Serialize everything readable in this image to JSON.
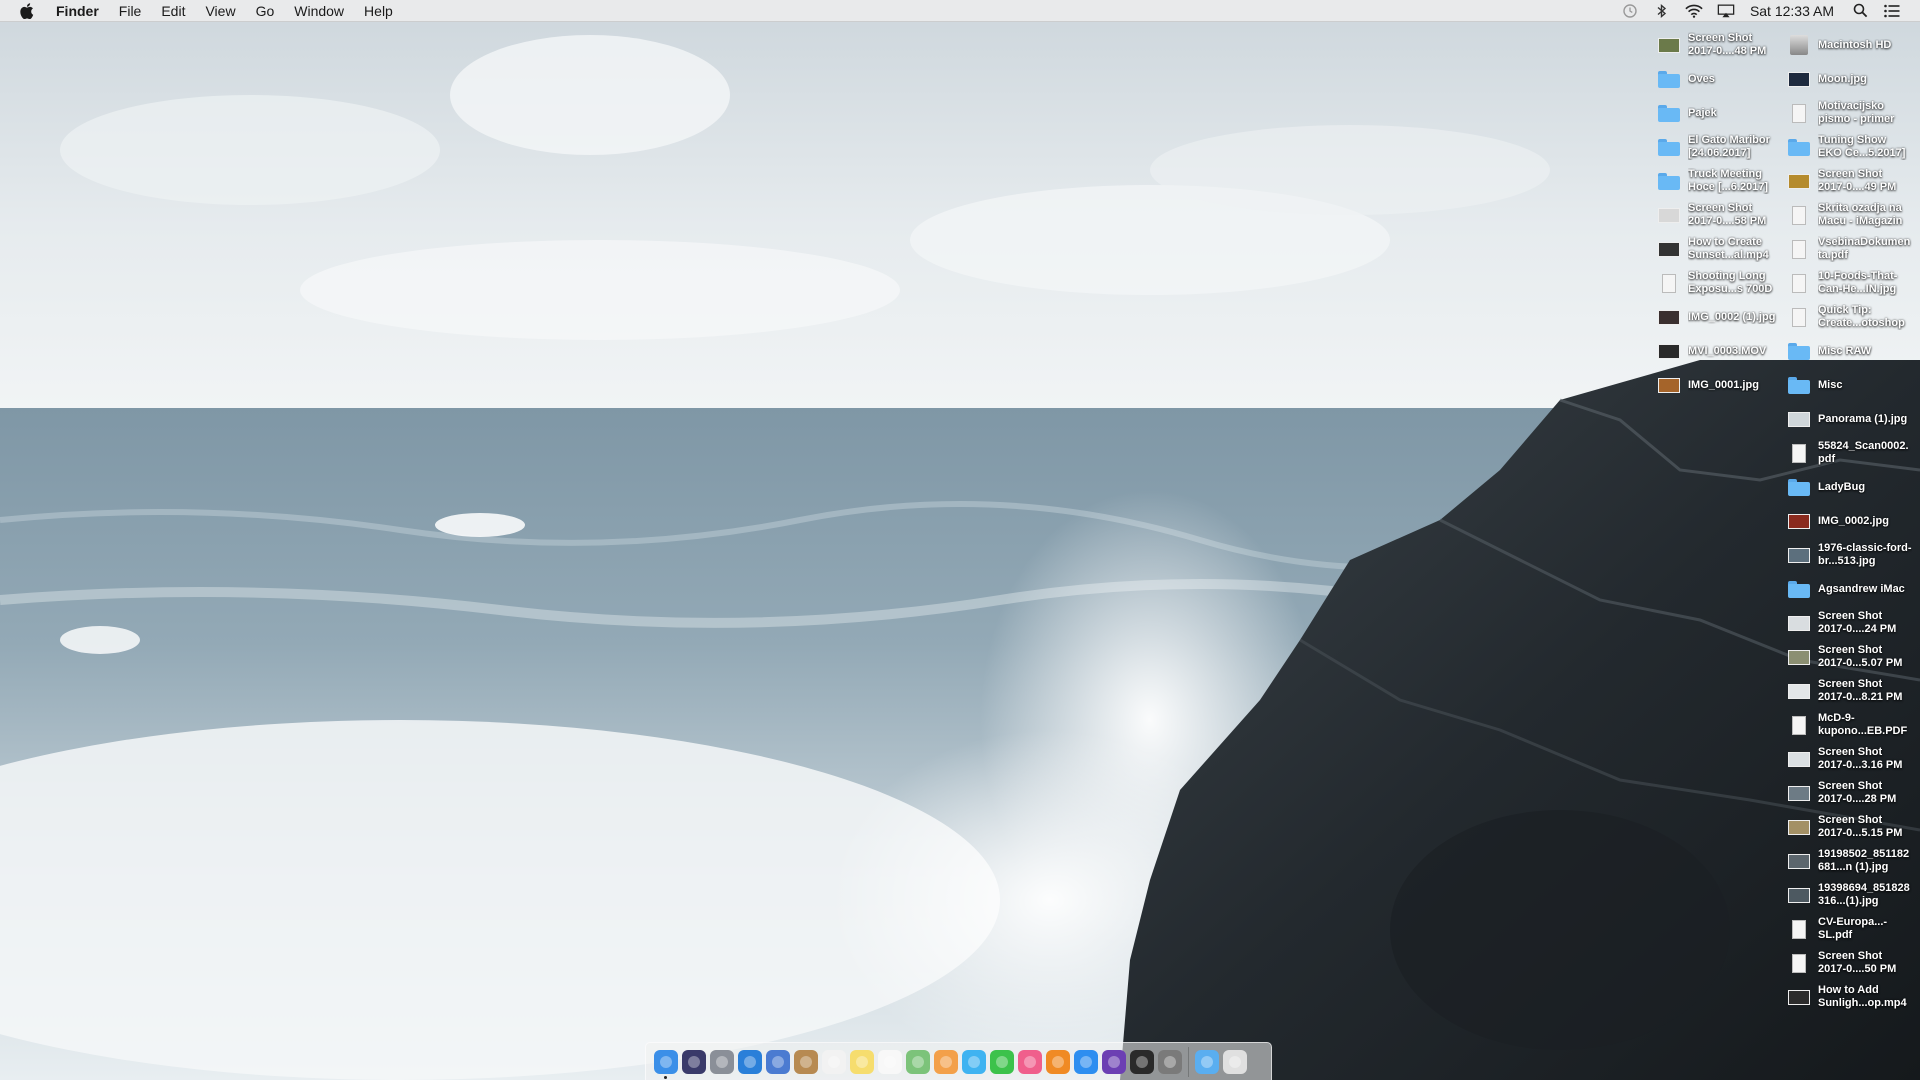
{
  "menubar": {
    "app_name": "Finder",
    "menus": [
      "File",
      "Edit",
      "View",
      "Go",
      "Window",
      "Help"
    ],
    "clock": "Sat 12:33 AM",
    "status_icons": [
      "time-machine-icon",
      "bluetooth-icon",
      "wifi-icon",
      "airplay-icon"
    ]
  },
  "desktop": {
    "column1": [
      {
        "name": "Screen Shot 2017-0....48 PM",
        "kind": "image",
        "color": "#6b7a4a"
      },
      {
        "name": "Oves",
        "kind": "folder"
      },
      {
        "name": "Pajek",
        "kind": "folder"
      },
      {
        "name": "El Gato Maribor [24.06.2017]",
        "kind": "folder"
      },
      {
        "name": "Truck Meeting Hoce [...6.2017]",
        "kind": "folder"
      },
      {
        "name": "Screen Shot 2017-0....58 PM",
        "kind": "image",
        "color": "#d8d8d8"
      },
      {
        "name": "How to Create Sunset...al.mp4",
        "kind": "image",
        "color": "#333333"
      },
      {
        "name": "Shooting Long Exposu...s 700D",
        "kind": "document"
      },
      {
        "name": "IMG_0002 (1).jpg",
        "kind": "image",
        "color": "#3a2f2f"
      },
      {
        "name": "MVI_0003.MOV",
        "kind": "image",
        "color": "#2a2a2a"
      },
      {
        "name": "IMG_0001.jpg",
        "kind": "image",
        "color": "#a5642a"
      }
    ],
    "column2": [
      {
        "name": "Macintosh HD",
        "kind": "disk"
      },
      {
        "name": "Moon.jpg",
        "kind": "image",
        "color": "#1e2a3e"
      },
      {
        "name": "Motivacijsko pismo - primer",
        "kind": "document"
      },
      {
        "name": "Tuning Show EKO Ce...5.2017]",
        "kind": "folder"
      },
      {
        "name": "Screen Shot 2017-0....49 PM",
        "kind": "image",
        "color": "#b58b2d"
      },
      {
        "name": "Skrita ozadja na Macu - iMagazin",
        "kind": "document"
      },
      {
        "name": "VsebinaDokumenta.pdf",
        "kind": "document"
      },
      {
        "name": "10-Foods-That-Can-He...IN.jpg",
        "kind": "document"
      },
      {
        "name": "Quick Tip: Create...otoshop",
        "kind": "document"
      },
      {
        "name": "Misc RAW",
        "kind": "folder"
      },
      {
        "name": "Misc",
        "kind": "folder"
      },
      {
        "name": "Panorama (1).jpg",
        "kind": "image",
        "color": "#cfd6da"
      },
      {
        "name": "55824_Scan0002.pdf",
        "kind": "document"
      },
      {
        "name": "LadyBug",
        "kind": "folder"
      },
      {
        "name": "IMG_0002.jpg",
        "kind": "image",
        "color": "#8a2a1e"
      },
      {
        "name": "1976-classic-ford-br...513.jpg",
        "kind": "image",
        "color": "#5c6f7d"
      },
      {
        "name": "Agsandrew iMac",
        "kind": "folder"
      },
      {
        "name": "Screen Shot 2017-0....24 PM",
        "kind": "image",
        "color": "#d9dde0"
      },
      {
        "name": "Screen Shot 2017-0...5.07 PM",
        "kind": "image",
        "color": "#8b8f72"
      },
      {
        "name": "Screen Shot 2017-0...8.21 PM",
        "kind": "image",
        "color": "#e3e6e8"
      },
      {
        "name": "McD-9-kupono...EB.PDF",
        "kind": "document"
      },
      {
        "name": "Screen Shot 2017-0...3.16 PM",
        "kind": "image",
        "color": "#dadfe2"
      },
      {
        "name": "Screen Shot 2017-0....28 PM",
        "kind": "image",
        "color": "#6d7b85"
      },
      {
        "name": "Screen Shot 2017-0...5.15 PM",
        "kind": "image",
        "color": "#a39065"
      },
      {
        "name": "19198502_851182681...n (1).jpg",
        "kind": "image",
        "color": "#5c666d"
      },
      {
        "name": "19398694_851828316...(1).jpg",
        "kind": "image",
        "color": "#4d5961"
      },
      {
        "name": "CV-Europa...-SL.pdf",
        "kind": "document"
      },
      {
        "name": "Screen Shot 2017-0....50 PM",
        "kind": "document"
      },
      {
        "name": "How to Add Sunligh...op.mp4",
        "kind": "image",
        "color": "#2c2c2c"
      }
    ]
  },
  "dock": {
    "apps": [
      {
        "icon": "finder-icon",
        "color": "#3b8fe8",
        "running": true
      },
      {
        "icon": "siri-icon",
        "color": "#3a3a6a"
      },
      {
        "icon": "launchpad-icon",
        "color": "#8a8f98"
      },
      {
        "icon": "safari-icon",
        "color": "#2a7fd9"
      },
      {
        "icon": "mail-icon",
        "color": "#4b7bd1"
      },
      {
        "icon": "contacts-icon",
        "color": "#b78a52"
      },
      {
        "icon": "calendar-icon",
        "color": "#f2f2f2"
      },
      {
        "icon": "notes-icon",
        "color": "#f6dd6e"
      },
      {
        "icon": "reminders-icon",
        "color": "#f8f8f8"
      },
      {
        "icon": "maps-icon",
        "color": "#7cc37a"
      },
      {
        "icon": "photos-icon",
        "color": "#f3a04a"
      },
      {
        "icon": "messages-icon",
        "color": "#3fb3f1"
      },
      {
        "icon": "facetime-icon",
        "color": "#3cc24b"
      },
      {
        "icon": "itunes-icon",
        "color": "#f05f8c"
      },
      {
        "icon": "ibooks-icon",
        "color": "#f08a24"
      },
      {
        "icon": "app-store-icon",
        "color": "#2e8ef0"
      },
      {
        "icon": "affinity-icon",
        "color": "#6c3fb3"
      },
      {
        "icon": "dvd-player-icon",
        "color": "#2a2a2a"
      },
      {
        "icon": "system-preferences-icon",
        "color": "#7a7a7a"
      }
    ],
    "extras": [
      {
        "icon": "downloads-folder-icon",
        "color": "#5aaef0"
      },
      {
        "icon": "trash-icon",
        "color": "#e0e0e0"
      }
    ]
  }
}
